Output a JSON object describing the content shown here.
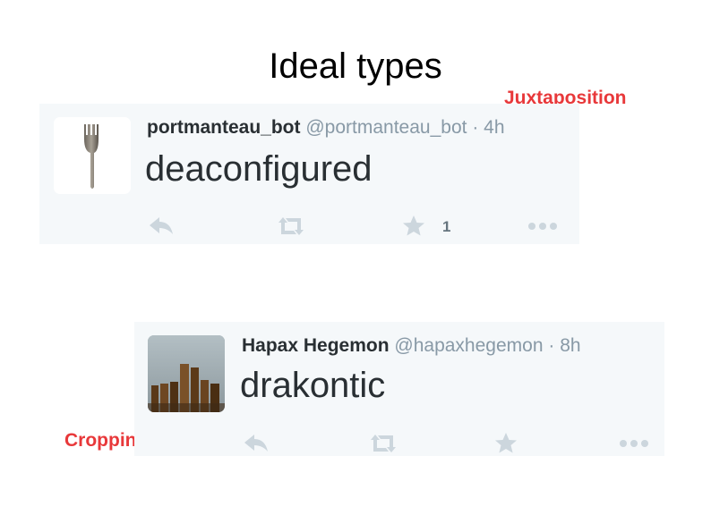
{
  "slide": {
    "title": "Ideal types",
    "annotations": {
      "juxtaposition": "Juxtaposition",
      "cropping": "Cropping"
    }
  },
  "tweets": [
    {
      "display_name": "portmanteau_bot",
      "handle": "@portmanteau_bot",
      "separator": "·",
      "time": "4h",
      "text": "deaconfigured",
      "favorite_count": "1",
      "avatar_icon": "spork-icon"
    },
    {
      "display_name": "Hapax Hegemon",
      "handle": "@hapaxhegemon",
      "separator": "·",
      "time": "8h",
      "text": "drakontic",
      "favorite_count": "",
      "avatar_icon": "wooden-posts-photo"
    }
  ],
  "colors": {
    "annotation": "#e8383a",
    "tweet_background": "#f5f8fa",
    "name": "#292f33",
    "muted": "#8899a6",
    "action_icon": "#ccd6dd"
  }
}
